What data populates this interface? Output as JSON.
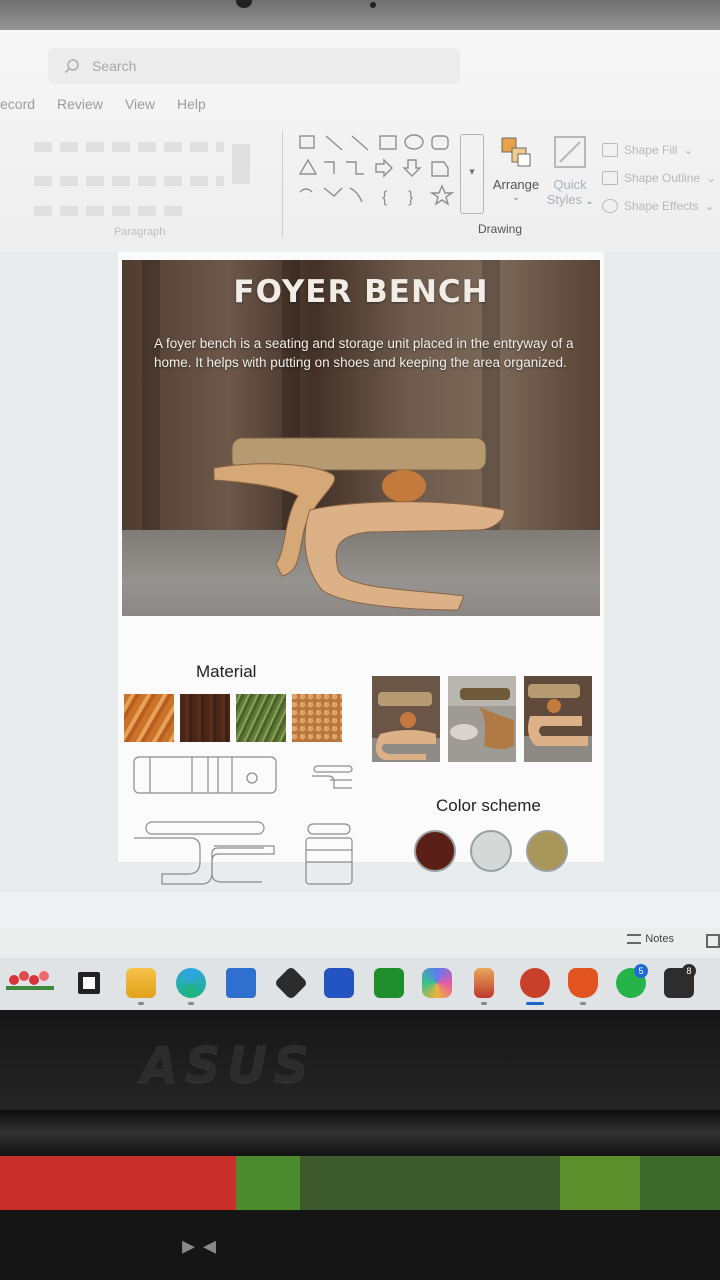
{
  "ribbon": {
    "search_placeholder": "Search",
    "tabs": [
      "ecord",
      "Review",
      "View",
      "Help"
    ],
    "group_labels": {
      "paragraph": "Paragraph",
      "drawing": "Drawing"
    },
    "arrange_label": "Arrange",
    "quick_styles_label_1": "Quick",
    "quick_styles_label_2": "Styles",
    "shape_fill": "Shape Fill",
    "shape_outline": "Shape Outline",
    "shape_effects": "Shape Effects"
  },
  "slide": {
    "title": "FOYER BENCH",
    "description": "A foyer bench is a seating and storage unit placed in the entryway of a home. It helps with putting on shoes and keeping the area organized.",
    "material_heading": "Material",
    "material_swatches": [
      "light-wood",
      "dark-walnut",
      "green-leaf-fiber",
      "cork-texture"
    ],
    "color_heading": "Color scheme",
    "colors": [
      "#5a1f16",
      "#d4d8d6",
      "#a8965a"
    ]
  },
  "status": {
    "notes_label": "Notes"
  },
  "taskbar": {
    "apps": [
      "flowers-widget",
      "task-view",
      "file-explorer",
      "edge-browser",
      "microsoft-store",
      "chat-gpt",
      "remote-app",
      "xbox",
      "copilot",
      "pencil-app",
      "powerpoint",
      "brave-browser",
      "whatsapp",
      "tray-app"
    ],
    "whatsapp_badge": "5",
    "tray_badge": "8"
  },
  "laptop": {
    "brand": "ASUS"
  }
}
